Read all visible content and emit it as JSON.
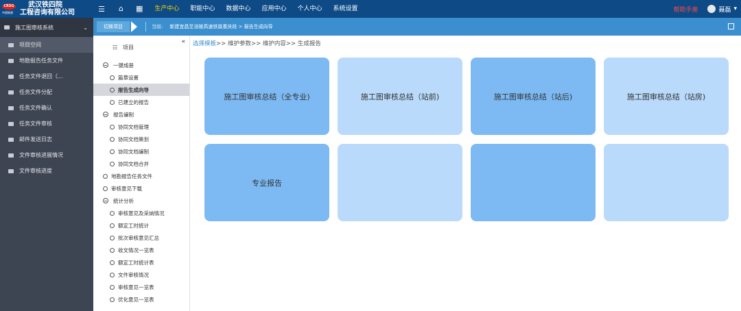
{
  "header": {
    "logo_badge": "CRSG",
    "logo_sub": "中国铁建",
    "company_line1": "武汉铁四院",
    "company_line2": "工程咨询有限公司",
    "nav": [
      "生产中心",
      "职能中心",
      "数据中心",
      "应用中心",
      "个人中心",
      "系统设置"
    ],
    "active_nav": "生产中心",
    "help": "帮助手册",
    "user": "聂磊"
  },
  "sidebar": {
    "system": "施工图审核系统",
    "items": [
      "项目空间",
      "地勘报告任务文件",
      "任务文件退回（...",
      "任务文件分配",
      "任务文件确认",
      "任务文件审核",
      "邮件发送日志",
      "文件审核进展情况",
      "文件审核进度"
    ]
  },
  "crumbbar": {
    "switch": "切换项目",
    "current_label": "当前:",
    "current": "新建宜昌至涪陵高速铁路重庆段  > 报告生成向导"
  },
  "tree": {
    "header": "项目",
    "nodes": [
      {
        "text": "一键成册",
        "level": 1,
        "type": "group"
      },
      {
        "text": "篇章设置",
        "level": 2,
        "type": "leaf"
      },
      {
        "text": "报告生成向导",
        "level": 2,
        "type": "leaf",
        "selected": true
      },
      {
        "text": "已建立的报告",
        "level": 2,
        "type": "leaf"
      },
      {
        "text": "报告编制",
        "level": 1,
        "type": "group"
      },
      {
        "text": "协同文档管理",
        "level": 2,
        "type": "leaf"
      },
      {
        "text": "协同文档策划",
        "level": 2,
        "type": "leaf"
      },
      {
        "text": "协同文档编制",
        "level": 2,
        "type": "leaf"
      },
      {
        "text": "协同文档合并",
        "level": 2,
        "type": "leaf"
      },
      {
        "text": "地勘报告任务文件",
        "level": 1,
        "type": "leaf"
      },
      {
        "text": "审核意见下载",
        "level": 1,
        "type": "leaf"
      },
      {
        "text": "统计分析",
        "level": 1,
        "type": "group"
      },
      {
        "text": "审核意见及采纳情况",
        "level": 2,
        "type": "leaf"
      },
      {
        "text": "额定工时统计",
        "level": 2,
        "type": "leaf"
      },
      {
        "text": "批次审核意见汇总",
        "level": 2,
        "type": "leaf"
      },
      {
        "text": "收文情况一览表",
        "level": 2,
        "type": "leaf"
      },
      {
        "text": "额定工时统计表",
        "level": 2,
        "type": "leaf"
      },
      {
        "text": "文件审核情况",
        "level": 2,
        "type": "leaf"
      },
      {
        "text": "审核意见一览表",
        "level": 2,
        "type": "leaf"
      },
      {
        "text": "优化意见一览表",
        "level": 2,
        "type": "leaf"
      }
    ]
  },
  "main": {
    "path_link": "选择模板",
    "path_rest": ">> 维护参数>> 维护内容>> 生成报告",
    "cards": [
      {
        "label": "施工图审核总结（全专业)",
        "tone": "dark"
      },
      {
        "label": "施工图审核总结（站前)",
        "tone": "light"
      },
      {
        "label": "施工图审核总结（站后)",
        "tone": "dark"
      },
      {
        "label": "施工图审核总结（站房)",
        "tone": "light"
      },
      {
        "label": "专业报告",
        "tone": "dark"
      },
      {
        "label": "",
        "tone": "light"
      },
      {
        "label": "",
        "tone": "dark"
      },
      {
        "label": "",
        "tone": "light"
      }
    ]
  }
}
